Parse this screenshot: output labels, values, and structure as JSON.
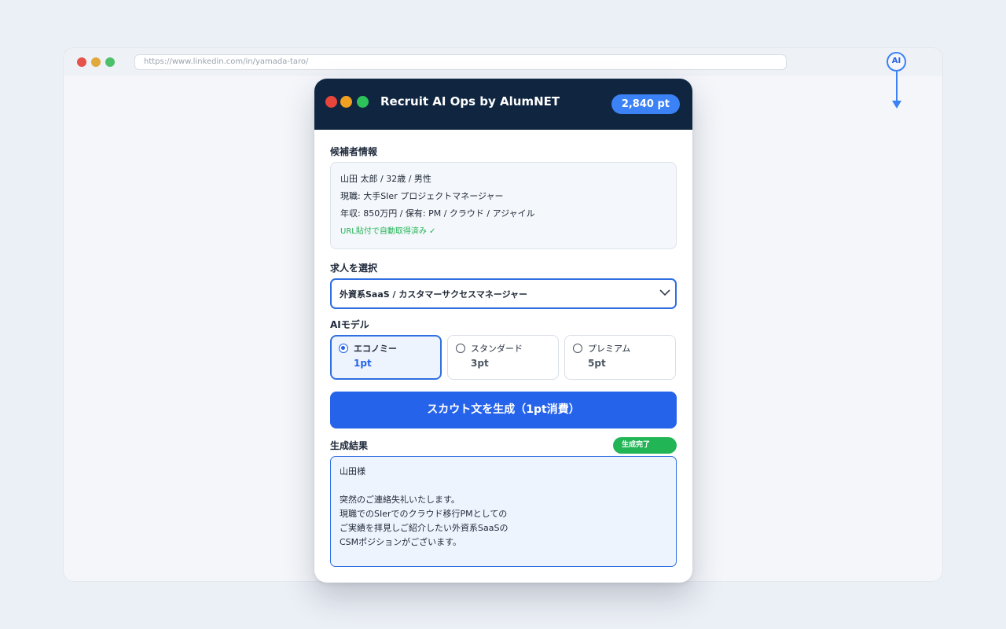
{
  "browser": {
    "url": "https://www.linkedin.com/in/yamada-taro/",
    "ai_badge": "AI"
  },
  "panel": {
    "title": "Recruit AI Ops by AlumNET",
    "points": "2,840 pt"
  },
  "candidate": {
    "section_label": "候補者情報",
    "line1": "山田 太郎 / 32歳 / 男性",
    "line2": "現職: 大手SIer プロジェクトマネージャー",
    "line3": "年収: 850万円  /  保有: PM / クラウド / アジャイル",
    "status": "URL貼付で自動取得済み  ✓"
  },
  "job": {
    "section_label": "求人を選択",
    "selected": "外資系SaaS / カスタマーサクセスマネージャー"
  },
  "models": {
    "section_label": "AIモデル",
    "options": [
      {
        "name": "エコノミー",
        "cost": "1pt",
        "selected": true
      },
      {
        "name": "スタンダード",
        "cost": "3pt",
        "selected": false
      },
      {
        "name": "プレミアム",
        "cost": "5pt",
        "selected": false
      }
    ]
  },
  "generate_label": "スカウト文を生成（1pt消費）",
  "result": {
    "section_label": "生成結果",
    "status_badge": "生成完了",
    "text": "山田様\n\n突然のご連絡失礼いたします。\n現職でのSIerでのクラウド移行PMとしての\nご実績を拝見しご紹介したい外資系SaaSの\nCSMポジションがございます。"
  },
  "colors": {
    "accent": "#2563eb",
    "header": "#0f2540",
    "success": "#22b556"
  }
}
